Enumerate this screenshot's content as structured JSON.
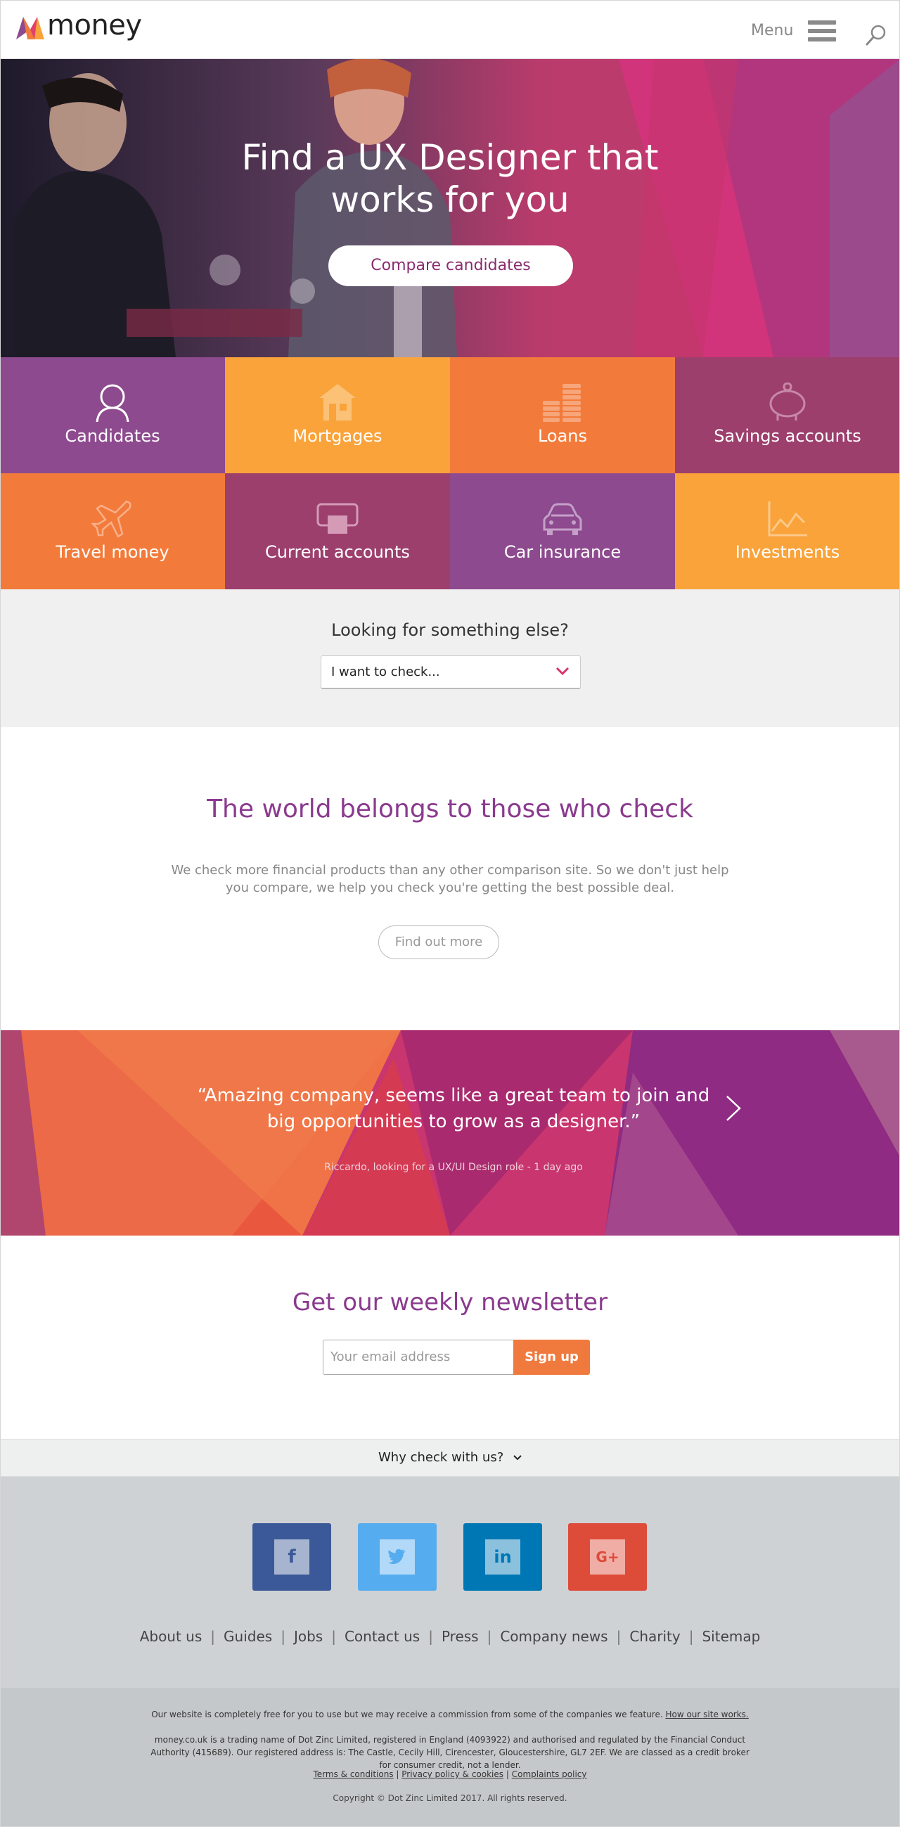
{
  "header": {
    "logo_text": "money",
    "menu_label": "Menu",
    "icons": [
      "money-logo-icon",
      "hamburger-icon",
      "search-icon"
    ]
  },
  "hero": {
    "title": "Find a UX Designer that works for you",
    "button_label": "Compare candidates"
  },
  "categories": [
    {
      "label": "Candidates",
      "icon": "person-icon",
      "color": "#8e4a8e"
    },
    {
      "label": "Mortgages",
      "icon": "house-icon",
      "color": "#f9a33a"
    },
    {
      "label": "Loans",
      "icon": "coins-icon",
      "color": "#f27b3b"
    },
    {
      "label": "Savings accounts",
      "icon": "piggy-bank-icon",
      "color": "#9c3f6d"
    },
    {
      "label": "Travel money",
      "icon": "plane-icon",
      "color": "#f27b3b"
    },
    {
      "label": "Current accounts",
      "icon": "card-icon",
      "color": "#9c3f6d"
    },
    {
      "label": "Car insurance",
      "icon": "car-icon",
      "color": "#8e4a8e"
    },
    {
      "label": "Investments",
      "icon": "chart-icon",
      "color": "#f9a33a"
    }
  ],
  "looking": {
    "title": "Looking for something else?",
    "select_value": "I want to check..."
  },
  "world": {
    "title": "The world belongs to those who check",
    "text": "We check more financial products than any other comparison site. So we don't just help you compare, we help you check you're getting the best possible deal.",
    "button_label": "Find out more"
  },
  "testimonial": {
    "quote": "“Amazing company, seems like a great team to join and big opportunities to grow as a designer.”",
    "author": "Riccardo, looking for a UX/UI Design role - 1 day ago"
  },
  "newsletter": {
    "title": "Get our weekly newsletter",
    "input_placeholder": "Your email address",
    "button_label": "Sign up"
  },
  "why": {
    "label": "Why check with us?"
  },
  "social": [
    {
      "name": "facebook",
      "glyph": "f",
      "color": "#3b5998",
      "glyph_color": "#3b5998"
    },
    {
      "name": "twitter",
      "glyph": "t",
      "color": "#55acee",
      "glyph_color": "#55acee"
    },
    {
      "name": "linkedin",
      "glyph": "in",
      "color": "#0077b5",
      "glyph_color": "#0077b5"
    },
    {
      "name": "google-plus",
      "glyph": "G+",
      "color": "#dd4b39",
      "glyph_color": "#dd4b39"
    }
  ],
  "footer_links": [
    "About us",
    "Guides",
    "Jobs",
    "Contact us",
    "Press",
    "Company news",
    "Charity",
    "Sitemap"
  ],
  "legal": {
    "line1_text": "Our website is completely free for you to use but we may receive a commission from some of the companies we feature.",
    "line1_link": "How our site works.",
    "line2": "money.co.uk is a trading name of Dot Zinc Limited, registered in England (4093922) and authorised and regulated by the Financial Conduct Authority (415689). Our registered address is: The Castle, Cecily Hill, Cirencester, Gloucestershire, GL7 2EF. We are classed as a credit broker for consumer credit, not a lender.",
    "links": [
      "Terms & conditions",
      "Privacy policy & cookies",
      "Complaints policy"
    ],
    "copyright": "Copyright © Dot Zinc Limited 2017. All rights reserved."
  }
}
